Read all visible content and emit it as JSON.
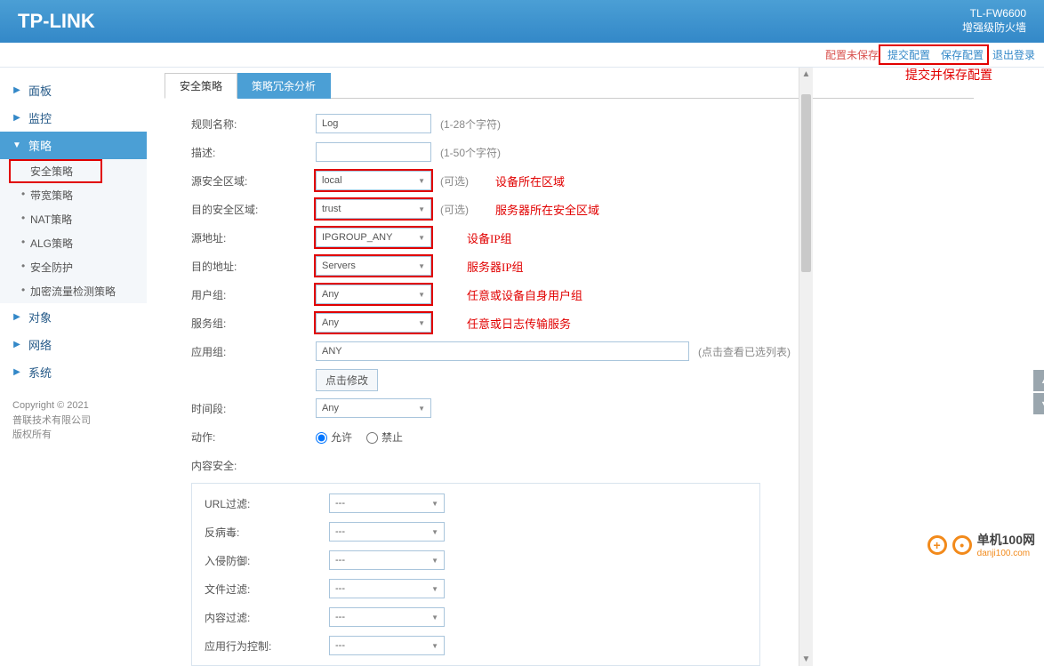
{
  "header": {
    "logo": "TP-LINK",
    "model": "TL-FW6600",
    "model_sub": "增强级防火墙"
  },
  "topbar": {
    "unsaved": "配置未保存",
    "submit": "提交配置",
    "save": "保存配置",
    "logout": "退出登录",
    "annotation": "提交并保存配置"
  },
  "nav": {
    "panel": "面板",
    "monitor": "监控",
    "policy": "策略",
    "sub": [
      "安全策略",
      "带宽策略",
      "NAT策略",
      "ALG策略",
      "安全防护",
      "加密流量检测策略"
    ],
    "object": "对象",
    "network": "网络",
    "system": "系统"
  },
  "copyright": {
    "line1": "Copyright © 2021",
    "line2": "普联技术有限公司",
    "line3": "版权所有"
  },
  "tabs": {
    "active": "安全策略",
    "other": "策略冗余分析"
  },
  "form": {
    "rule_name_label": "规则名称:",
    "rule_name_value": "Log",
    "rule_name_hint": "(1-28个字符)",
    "desc_label": "描述:",
    "desc_hint": "(1-50个字符)",
    "src_zone_label": "源安全区域:",
    "src_zone_value": "local",
    "src_zone_hint": "(可选)",
    "src_zone_anno": "设备所在区域",
    "dst_zone_label": "目的安全区域:",
    "dst_zone_value": "trust",
    "dst_zone_hint": "(可选)",
    "dst_zone_anno": "服务器所在安全区域",
    "src_addr_label": "源地址:",
    "src_addr_value": "IPGROUP_ANY",
    "src_addr_anno": "设备IP组",
    "dst_addr_label": "目的地址:",
    "dst_addr_value": "Servers",
    "dst_addr_anno": "服务器IP组",
    "user_group_label": "用户组:",
    "user_group_value": "Any",
    "user_group_anno": "任意或设备自身用户组",
    "service_group_label": "服务组:",
    "service_group_value": "Any",
    "service_group_anno": "任意或日志传输服务",
    "app_group_label": "应用组:",
    "app_group_value": "ANY",
    "app_group_hint": "(点击查看已选列表)",
    "modify_btn": "点击修改",
    "time_label": "时间段:",
    "time_value": "Any",
    "action_label": "动作:",
    "action_allow": "允许",
    "action_deny": "禁止",
    "content_sec_label": "内容安全:",
    "url_filter_label": "URL过滤:",
    "antivirus_label": "反病毒:",
    "ips_label": "入侵防御:",
    "file_filter_label": "文件过滤:",
    "content_filter_label": "内容过滤:",
    "behavior_label": "应用行为控制:",
    "empty_value": "---"
  },
  "side": {
    "top": "返回顶部",
    "bottom": "前往底部"
  },
  "watermark": {
    "text": "单机100网",
    "sub": "danji100.com"
  }
}
